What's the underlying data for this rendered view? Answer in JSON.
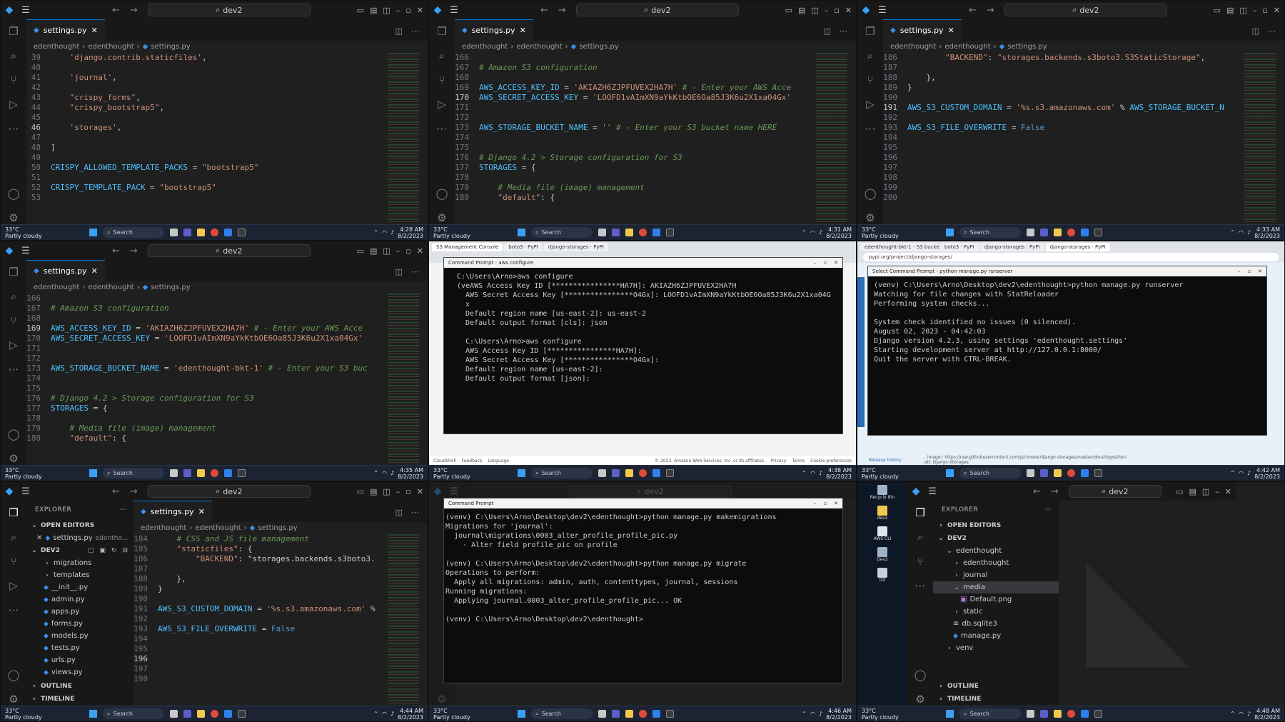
{
  "vscode": {
    "search_label": "dev2",
    "tab_label": "settings.py",
    "breadcrumb": [
      "edenthought",
      "edenthought",
      "settings.py"
    ]
  },
  "taskbar": {
    "temp": "33°C",
    "weather": "Partly cloudy",
    "search": "Search"
  },
  "panels": {
    "p1": {
      "clock": [
        "4:28 AM",
        "8/2/2023"
      ],
      "lines": [
        {
          "n": "39",
          "t": "    'django.contrib.staticfiles',"
        },
        {
          "n": "40",
          "t": ""
        },
        {
          "n": "41",
          "t": "    'journal',"
        },
        {
          "n": "42",
          "t": ""
        },
        {
          "n": "43",
          "t": "    \"crispy_forms\","
        },
        {
          "n": "44",
          "t": "    \"crispy_bootstrap5\","
        },
        {
          "n": "45",
          "t": ""
        },
        {
          "n": "46",
          "t": "    'storages',"
        },
        {
          "n": "47",
          "t": ""
        },
        {
          "n": "48",
          "t": "]"
        },
        {
          "n": "49",
          "t": ""
        },
        {
          "n": "50",
          "t": "CRISPY_ALLOWED_TEMPLATE_PACKS = \"bootstrap5\""
        },
        {
          "n": "51",
          "t": ""
        },
        {
          "n": "52",
          "t": "CRISPY_TEMPLATE_PACK = \"bootstrap5\""
        },
        {
          "n": "53",
          "t": ""
        }
      ]
    },
    "p2": {
      "clock": [
        "4:31 AM",
        "8/2/2023"
      ],
      "lines": [
        {
          "n": "166",
          "t": ""
        },
        {
          "n": "167",
          "t": "# Amazon S3 configuration"
        },
        {
          "n": "168",
          "t": ""
        },
        {
          "n": "169",
          "t": "AWS_ACCESS_KEY_ID = 'AKIAZH6ZJPFUVEX2HA7H' # - Enter your AWS Acce"
        },
        {
          "n": "170",
          "t": "AWS_SECRET_ACCESS_KEY = 'LOOFD1vAImXN9aYkKtbOE6Oa85J3K6u2X1xa04Gx'"
        },
        {
          "n": "171",
          "t": ""
        },
        {
          "n": "172",
          "t": ""
        },
        {
          "n": "173",
          "t": "AWS_STORAGE_BUCKET_NAME = '' # - Enter your S3 bucket name HERE"
        },
        {
          "n": "174",
          "t": ""
        },
        {
          "n": "175",
          "t": ""
        },
        {
          "n": "176",
          "t": "# Django 4.2 > Storage configuration for S3"
        },
        {
          "n": "177",
          "t": "STORAGES = {"
        },
        {
          "n": "178",
          "t": ""
        },
        {
          "n": "179",
          "t": "    # Media file (image) management"
        },
        {
          "n": "180",
          "t": "    \"default\": {"
        }
      ]
    },
    "p3": {
      "clock": [
        "4:33 AM",
        "8/2/2023"
      ],
      "lines": [
        {
          "n": "186",
          "t": "        \"BACKEND\": \"storages.backends.s3boto3.S3StaticStorage\","
        },
        {
          "n": "187",
          "t": ""
        },
        {
          "n": "188",
          "t": "    },"
        },
        {
          "n": "189",
          "t": "}"
        },
        {
          "n": "190",
          "t": ""
        },
        {
          "n": "191",
          "t": "AWS_S3_CUSTOM_DOMAIN = '%s.s3.amazonaws.com' % AWS_STORAGE_BUCKET_N"
        },
        {
          "n": "192",
          "t": ""
        },
        {
          "n": "193",
          "t": "AWS_S3_FILE_OVERWRITE = False"
        },
        {
          "n": "194",
          "t": ""
        },
        {
          "n": "195",
          "t": ""
        },
        {
          "n": "196",
          "t": ""
        },
        {
          "n": "197",
          "t": ""
        },
        {
          "n": "198",
          "t": ""
        },
        {
          "n": "199",
          "t": ""
        },
        {
          "n": "200",
          "t": ""
        }
      ]
    },
    "p4": {
      "clock": [
        "4:35 AM",
        "8/2/2023"
      ],
      "lines": [
        {
          "n": "166",
          "t": ""
        },
        {
          "n": "167",
          "t": "# Amazon S3 configuration"
        },
        {
          "n": "168",
          "t": ""
        },
        {
          "n": "169",
          "t": "AWS_ACCESS_KEY_ID = 'AKIAZH6ZJPFUVEX2HA7H' # - Enter your AWS Acce"
        },
        {
          "n": "170",
          "t": "AWS_SECRET_ACCESS_KEY = 'LOOFD1vAImXN9aYkKtbOE6Oa85J3K6u2X1xa04Gx'"
        },
        {
          "n": "171",
          "t": ""
        },
        {
          "n": "172",
          "t": ""
        },
        {
          "n": "173",
          "t": "AWS_STORAGE_BUCKET_NAME = 'edenthought-bkt-1' # - Enter your S3 buc"
        },
        {
          "n": "174",
          "t": ""
        },
        {
          "n": "175",
          "t": ""
        },
        {
          "n": "176",
          "t": "# Django 4.2 > Storage configuration for S3"
        },
        {
          "n": "177",
          "t": "STORAGES = {"
        },
        {
          "n": "178",
          "t": ""
        },
        {
          "n": "179",
          "t": "    # Media file (image) management"
        },
        {
          "n": "180",
          "t": "    \"default\": {"
        }
      ]
    },
    "p5": {
      "clock": [
        "4:38 AM",
        "8/2/2023"
      ],
      "browser_tabs": [
        "S3 Management Console",
        "boto3 · PyPI",
        "django-storages · PyPI"
      ],
      "window_title": "Command Prompt - aws configure",
      "terminal": [
        "C:\\Users\\Arno>aws configure",
        "(veAWS Access Key ID [****************HA7H]: AKIAZH6ZJPFUVEX2HA7H",
        "  AWS Secret Access Key [****************O4Gx]: LOOFD1vAImXN9aYkKtbOE6Oa85J3K6u2X1xa04G",
        "  x",
        "  Default region name [us-east-2]: us-east-2",
        "  Default output format [cls]: json",
        "",
        "  C:\\Users\\Arno>aws configure",
        "  AWS Access Key ID [****************HA7H]:",
        "  AWS Secret Access Key [****************O4Gx]:",
        "  Default region name [us-east-2]:",
        "  Default output format [json]:"
      ],
      "footer": [
        "CloudShell",
        "Feedback",
        "Language",
        "© 2023, Amazon Web Services, Inc. or its affiliates.",
        "Privacy",
        "Terms",
        "Cookie preferences"
      ]
    },
    "p6": {
      "clock": [
        "4:42 AM",
        "8/2/2023"
      ],
      "browser_tabs": [
        "edenthought-bkt-1 - S3 bucket",
        "boto3 · PyPI",
        "django-storages · PyPI",
        "django-storages · PyPI"
      ],
      "url": "pypi.org/project/django-storages/",
      "window_title": "Select Command Prompt - python manage.py runserver",
      "terminal": [
        "(venv) C:\\Users\\Arno\\Desktop\\dev2\\edenthought>python manage.py runserver",
        "Watching for file changes with StatReloader",
        "Performing system checks...",
        "",
        "System check identified no issues (0 silenced).",
        "August 02, 2023 - 04:42:03",
        "Django version 4.2.3, using settings 'edenthought.settings'",
        "Starting development server at http://127.0.0.1:8000/",
        "Quit the server with CTRL-BREAK."
      ],
      "footer_link": "Release history",
      "footer_img": ".. image:: https://raw.githubusercontent.com/jschneier/django-storages/master/docs/logos/hori",
      "footer_alt": ":alt: Django-Storages"
    },
    "p7": {
      "clock": [
        "4:44 AM",
        "8/2/2023"
      ],
      "explorer_title": "EXPLORER",
      "open_editors": "OPEN EDITORS",
      "open_file": "settings.py",
      "open_file_path": "edentho...",
      "root": "DEV2",
      "tree": [
        "migrations",
        "templates",
        "__init__.py",
        "admin.py",
        "apps.py",
        "forms.py",
        "models.py",
        "tests.py",
        "urls.py",
        "views.py"
      ],
      "outline": "OUTLINE",
      "timeline": "TIMELINE",
      "lines": [
        {
          "n": "184",
          "t": "    # CSS and JS file management"
        },
        {
          "n": "185",
          "t": "    \"staticfiles\": {"
        },
        {
          "n": "186",
          "t": "        \"BACKEND\": \"storages.backends.s3boto3."
        },
        {
          "n": "187",
          "t": ""
        },
        {
          "n": "188",
          "t": "    },"
        },
        {
          "n": "189",
          "t": "}"
        },
        {
          "n": "190",
          "t": ""
        },
        {
          "n": "191",
          "t": "AWS_S3_CUSTOM_DOMAIN = '%s.s3.amazonaws.com' %"
        },
        {
          "n": "192",
          "t": ""
        },
        {
          "n": "193",
          "t": "AWS_S3_FILE_OVERWRITE = False"
        },
        {
          "n": "194",
          "t": ""
        },
        {
          "n": "195",
          "t": ""
        },
        {
          "n": "196",
          "t": ""
        },
        {
          "n": "197",
          "t": ""
        },
        {
          "n": "198",
          "t": ""
        }
      ]
    },
    "p8": {
      "clock": [
        "4:46 AM",
        "8/2/2023"
      ],
      "window_title": "Command Prompt",
      "terminal": [
        "(venv) C:\\Users\\Arno\\Desktop\\dev2\\edenthought>python manage.py makemigrations",
        "Migrations for 'journal':",
        "  journal\\migrations\\0003_alter_profile_profile_pic.py",
        "    - Alter field profile_pic on profile",
        "",
        "(venv) C:\\Users\\Arno\\Desktop\\dev2\\edenthought>python manage.py migrate",
        "Operations to perform:",
        "  Apply all migrations: admin, auth, contenttypes, journal, sessions",
        "Running migrations:",
        "  Applying journal.0003_alter_profile_profile_pic... OK",
        "",
        "(venv) C:\\Users\\Arno\\Desktop\\dev2\\edenthought>"
      ]
    },
    "p9": {
      "clock": [
        "4:48 AM",
        "8/2/2023"
      ],
      "desktop_icons": [
        "Recycle Bin",
        "dev2",
        "AWS CLI",
        "Dev2",
        "Git"
      ],
      "explorer_title": "EXPLORER",
      "open_editors": "OPEN EDITORS",
      "root": "DEV2",
      "tree": [
        {
          "label": "edenthought",
          "depth": 1,
          "open": true
        },
        {
          "label": "edenthought",
          "depth": 2,
          "open": false
        },
        {
          "label": "journal",
          "depth": 2,
          "open": false
        },
        {
          "label": "media",
          "depth": 2,
          "open": true
        },
        {
          "label": "Default.png",
          "depth": 3,
          "file": true
        },
        {
          "label": "static",
          "depth": 2,
          "open": false
        },
        {
          "label": "db.sqlite3",
          "depth": 2,
          "file": true
        },
        {
          "label": "manage.py",
          "depth": 2,
          "file": true
        },
        {
          "label": "venv",
          "depth": 1,
          "open": false
        }
      ],
      "outline": "OUTLINE",
      "timeline": "TIMELINE"
    }
  },
  "colors": {
    "accent": "#0078d4",
    "string": "#ce9178",
    "variable": "#4fc1ff",
    "comment": "#6a9955"
  }
}
